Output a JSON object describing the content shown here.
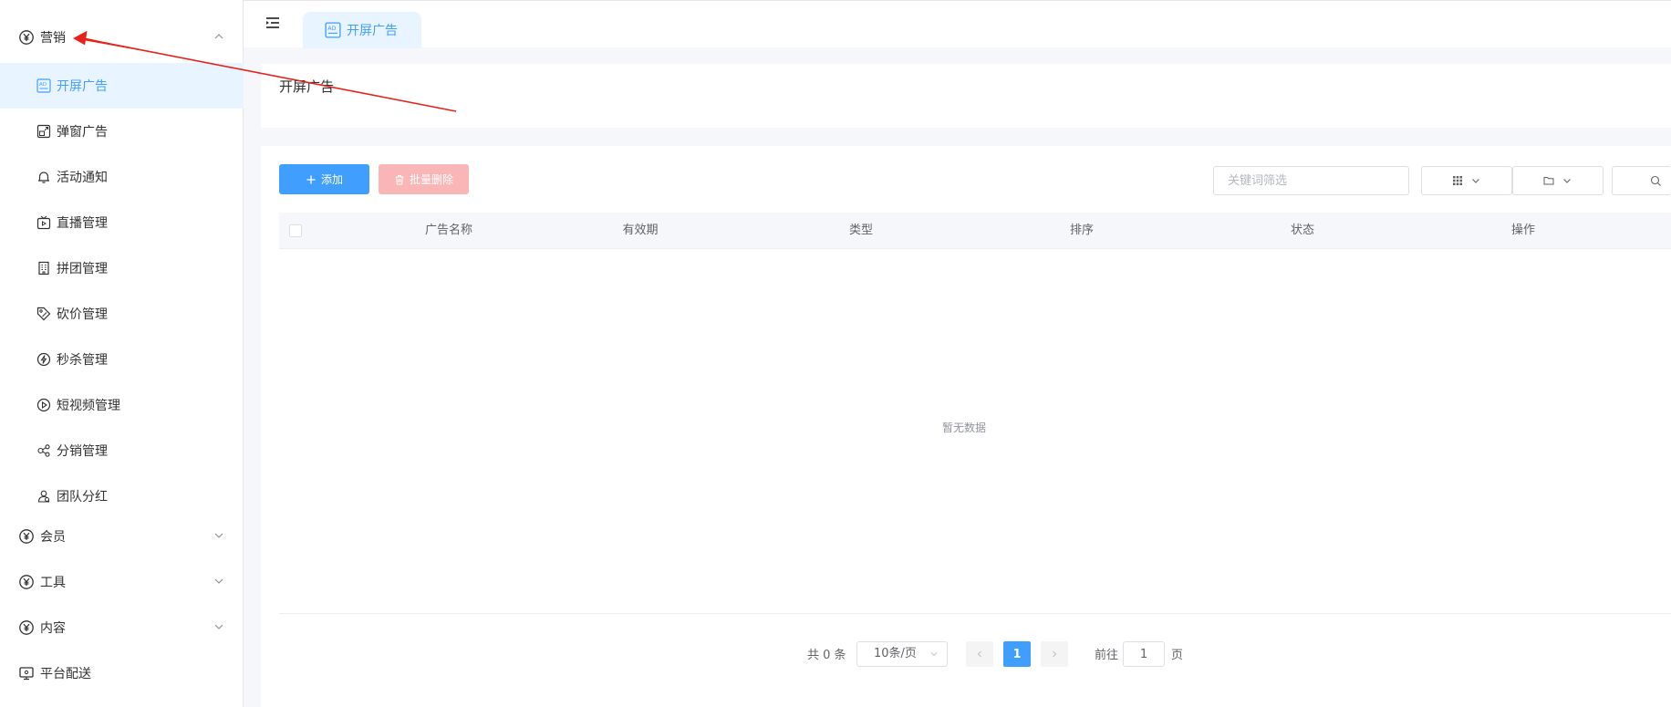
{
  "sidebar": {
    "groups": [
      {
        "label": "营销",
        "icon": "yen-icon",
        "expanded": true
      },
      {
        "label": "会员",
        "icon": "yen-icon",
        "expanded": false
      },
      {
        "label": "工具",
        "icon": "yen-icon",
        "expanded": false
      },
      {
        "label": "内容",
        "icon": "yen-icon",
        "expanded": false
      },
      {
        "label": "平台配送",
        "icon": "monitor-icon"
      }
    ],
    "items": [
      {
        "label": "开屏广告",
        "icon": "ad-icon",
        "active": true
      },
      {
        "label": "弹窗广告",
        "icon": "popup-icon"
      },
      {
        "label": "活动通知",
        "icon": "bell-icon"
      },
      {
        "label": "直播管理",
        "icon": "tv-icon"
      },
      {
        "label": "拼团管理",
        "icon": "building-icon"
      },
      {
        "label": "砍价管理",
        "icon": "tag-icon"
      },
      {
        "label": "秒杀管理",
        "icon": "lightning-icon"
      },
      {
        "label": "短视频管理",
        "icon": "play-icon"
      },
      {
        "label": "分销管理",
        "icon": "share-icon"
      },
      {
        "label": "团队分红",
        "icon": "team-icon"
      }
    ]
  },
  "header": {
    "tab_label": "开屏广告"
  },
  "page": {
    "title": "开屏广告"
  },
  "toolbar": {
    "add_label": "添加",
    "batch_delete_label": "批量删除",
    "search_placeholder": "关键词筛选"
  },
  "table": {
    "columns": [
      "广告名称",
      "有效期",
      "类型",
      "排序",
      "状态",
      "操作"
    ],
    "rows": [],
    "empty_text": "暂无数据"
  },
  "pagination": {
    "total_text": "共 0 条",
    "page_size": "10条/页",
    "current_page": "1",
    "goto_label": "前往",
    "goto_value": "1",
    "goto_suffix": "页"
  },
  "colors": {
    "primary": "#409eff",
    "danger_disabled": "#fab6b6",
    "active_bg": "#e8f4ff",
    "annotation_arrow": "#e8211b"
  }
}
